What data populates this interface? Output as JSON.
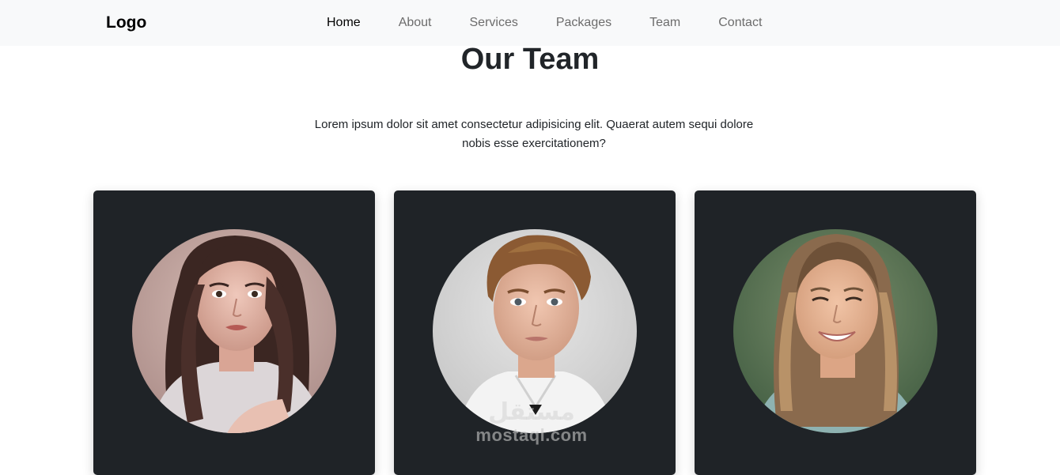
{
  "navbar": {
    "logo": "Logo",
    "links": [
      {
        "label": "Home",
        "active": true
      },
      {
        "label": "About",
        "active": false
      },
      {
        "label": "Services",
        "active": false
      },
      {
        "label": "Packages",
        "active": false
      },
      {
        "label": "Team",
        "active": false
      },
      {
        "label": "Contact",
        "active": false
      }
    ]
  },
  "section": {
    "title": "Our Team",
    "description": "Lorem ipsum dolor sit amet consectetur adipisicing elit. Quaerat autem sequi dolore nobis esse exercitationem?"
  },
  "team": [
    {
      "photo": "woman-portrait-dark-hair"
    },
    {
      "photo": "man-portrait-white-shirt"
    },
    {
      "photo": "woman-portrait-smiling"
    }
  ],
  "watermark": {
    "text": "mostaql.com"
  },
  "colors": {
    "navbar_bg": "#f8f9fa",
    "card_bg": "#1f2327",
    "text": "#212529",
    "nav_link": "#6c6c6c",
    "nav_active": "#000000"
  }
}
